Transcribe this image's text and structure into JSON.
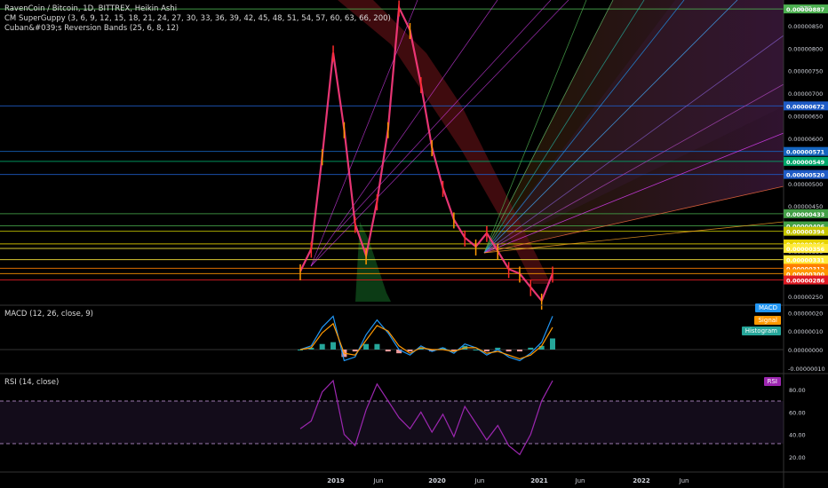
{
  "legend": {
    "title": "RavenCoin / Bitcoin, 1D, BITTREX, Heikin Ashi",
    "guppy": "CM SuperGuppy (3, 6, 9, 12, 15, 18, 21, 24, 27, 30, 33, 36, 39, 42, 45, 48, 51, 54, 57, 60, 63, 66, 200)",
    "reversion": "Cuban&#039;s Reversion Bands (25, 6, 8, 12)",
    "macd": "MACD (12, 26, close, 9)",
    "rsi": "RSI (14, close)"
  },
  "unit": "BTC",
  "badges": {
    "macd": "MACD",
    "signal": "Signal",
    "histogram": "Histogram",
    "rsi": "RSI"
  },
  "colors": {
    "background": "#000000",
    "axis_text": "#d1d4dc",
    "macd": "#2196f3",
    "signal": "#ff9800",
    "histogram": "#26a69a",
    "rsi": "#9c27b0",
    "up": "#ff3b7f",
    "down": "#ff2a2a"
  },
  "chart_data": [
    {
      "type": "line",
      "title": "RavenCoin / Bitcoin, 1D, BITTREX, Heikin Ashi",
      "x_ticks": [
        "2019",
        "Jun",
        "2020",
        "Jun",
        "2021",
        "Jun",
        "2022",
        "Jun"
      ],
      "y_ticks": [
        "0.00000850",
        "0.00000800",
        "0.00000750",
        "0.00000700",
        "0.00000650",
        "0.00000600",
        "0.00000550",
        "0.00000500",
        "0.00000450",
        "0.00000400",
        "0.00000350",
        "0.00000300",
        "0.00000250"
      ],
      "ylim": [
        2.3e-06,
        8.95e-06
      ],
      "price_levels": [
        {
          "value": "0.00000887",
          "color": "#4caf50"
        },
        {
          "value": "0.00000672",
          "color": "#1e5bc6"
        },
        {
          "value": "0.00000571",
          "color": "#1565c0"
        },
        {
          "value": "0.00000549",
          "color": "#00a86b"
        },
        {
          "value": "0.00000520",
          "color": "#1e5bc6"
        },
        {
          "value": "0.00000433",
          "color": "#43a047"
        },
        {
          "value": "0.00000406",
          "color": "#43a047"
        },
        {
          "value": "0.00000394",
          "color": "#c6c600"
        },
        {
          "value": "0.00000366",
          "color": "#e6d200"
        },
        {
          "value": "0.00000356",
          "color": "#ffeb3b"
        },
        {
          "value": "0.00000331",
          "color": "#ffeb3b"
        },
        {
          "value": "0.00000312",
          "color": "#ff7f00"
        },
        {
          "value": "0.00000300",
          "color": "#ff9800"
        },
        {
          "value": "0.00000286",
          "color": "#e01b24"
        }
      ],
      "series": [
        {
          "values": [
            3.05e-06,
            3.55e-06,
            5.6e-06,
            7.9e-06,
            6.2e-06,
            4.1e-06,
            3.4e-06,
            4.6e-06,
            6.2e-06,
            8.9e-06,
            8.4e-06,
            7.2e-06,
            5.8e-06,
            4.9e-06,
            4.2e-06,
            3.8e-06,
            3.6e-06,
            3.9e-06,
            3.5e-06,
            3.1e-06,
            3e-06,
            2.7e-06,
            2.4e-06,
            3e-06
          ]
        }
      ]
    },
    {
      "type": "line",
      "title": "MACD (12, 26, close, 9)",
      "y_ticks": [
        "0.00000020",
        "0.00000010",
        "0.00000000",
        "-0.00000010"
      ],
      "ylim": [
        -1.2e-07,
        2.3e-07
      ],
      "series": [
        {
          "values": [
            0.0,
            2e-08,
            1.2e-07,
            1.8e-07,
            -6e-08,
            -4e-08,
            8e-08,
            1.6e-07,
            9e-08,
            0.0,
            -3e-08,
            2e-08,
            -1e-08,
            1e-08,
            -2e-08,
            3e-08,
            1e-08,
            -3e-08,
            0.0,
            -4e-08,
            -6e-08,
            -2e-08,
            4e-08,
            1.8e-07
          ]
        },
        {
          "values": [
            0.0,
            1e-08,
            9e-08,
            1.4e-07,
            -2e-08,
            -3e-08,
            5e-08,
            1.3e-07,
            1e-07,
            2e-08,
            -2e-08,
            1e-08,
            0.0,
            0.0,
            -1e-08,
            1e-08,
            1e-08,
            -2e-08,
            -1e-08,
            -3e-08,
            -5e-08,
            -3e-08,
            2e-08,
            1.2e-07
          ]
        }
      ]
    },
    {
      "type": "line",
      "title": "RSI (14, close)",
      "y_ticks": [
        "80.00",
        "60.00",
        "40.00",
        "20.00"
      ],
      "ylim": [
        8,
        92
      ],
      "series": [
        {
          "values": [
            45,
            52,
            78,
            88,
            40,
            30,
            62,
            85,
            70,
            55,
            45,
            60,
            42,
            58,
            38,
            65,
            50,
            35,
            48,
            30,
            22,
            40,
            70,
            88
          ]
        }
      ]
    }
  ]
}
